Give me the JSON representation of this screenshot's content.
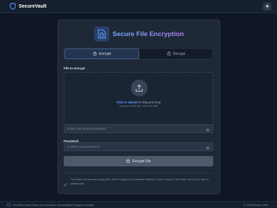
{
  "header": {
    "app_name": "SecureVault",
    "theme_icon": "sun-icon"
  },
  "card": {
    "title": "Secure File Encryption",
    "title_icon": "file-lock-icon",
    "tabs": [
      {
        "label": "Encrypt",
        "icon": "lock-icon",
        "active": true
      },
      {
        "label": "Decrypt",
        "icon": "unlock-icon",
        "active": false
      }
    ],
    "file_label": "File to encrypt",
    "dropzone": {
      "icon": "upload-icon",
      "link_text": "Click to upload",
      "rest_text": " or drag and drop",
      "sub_text": "Supports any file type • Max size 5MB"
    },
    "password": {
      "label": "Password",
      "placeholder": "Enter your secure password"
    },
    "confirm": {
      "label": "Confirm Password",
      "placeholder": "Confirm your password"
    },
    "encrypt_button": "Encrypt File",
    "notice": "Your files are secured using AES-256 encryption, processed entirely in your browser. We never store your files or passwords."
  },
  "footer": {
    "left_text": "Your files never leave your browser. All encryption happens locally.",
    "right_text": "© 2025 Dhrum Josh"
  },
  "colors": {
    "background": "#0f1724",
    "card": "#1e2837",
    "accent_blue": "#5aa0ff",
    "accent_purple": "#b27df2"
  }
}
